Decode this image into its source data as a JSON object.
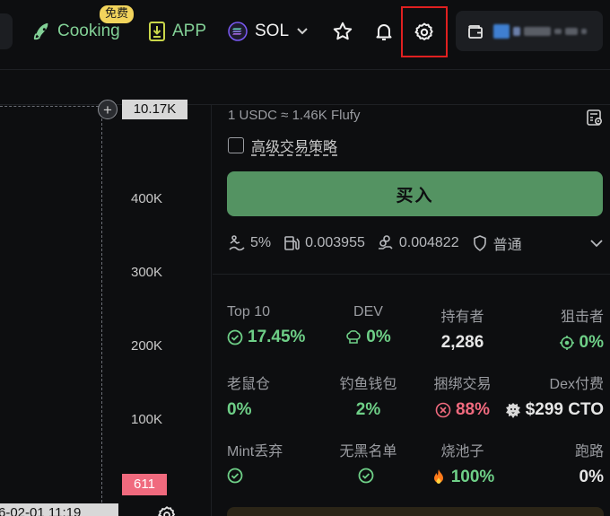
{
  "topbar": {
    "cooking_label": "Cooking",
    "free_badge": "免费",
    "app_label": "APP",
    "network_label": "SOL",
    "wallet_address_masked": "▪▪▪▪ ▪ ▪▪"
  },
  "chart": {
    "crosshair_price": "10.17K",
    "yticks": [
      "400K",
      "300K",
      "200K",
      "100K"
    ],
    "last_price_badge": "611",
    "crosshair_time": "6-02-01 11:19"
  },
  "trade": {
    "rate_text": "1 USDC ≈ 1.46K Flufy",
    "advanced_strategy_label": "高级交易策略",
    "buy_button_label": "买入",
    "slippage": "5%",
    "priority_fee": "0.003955",
    "tip_fee": "0.004822",
    "protection_mode": "普通"
  },
  "stats": [
    {
      "label": "Top 10",
      "value": "17.45%",
      "icon": "check-circle-icon",
      "color": "#6ecf87"
    },
    {
      "label": "DEV",
      "value": "0%",
      "icon": "chef-hat-icon",
      "color": "#6ecf87"
    },
    {
      "label": "持有者",
      "value": "2,286",
      "icon": "",
      "color": "#e6e6e6"
    },
    {
      "label": "狙击者",
      "value": "0%",
      "icon": "crosshair-icon",
      "color": "#6ecf87"
    },
    {
      "label": "老鼠仓",
      "value": "0%",
      "icon": "",
      "color": "#6ecf87"
    },
    {
      "label": "钓鱼钱包",
      "value": "2%",
      "icon": "",
      "color": "#6ecf87"
    },
    {
      "label": "捆绑交易",
      "value": "88%",
      "icon": "x-circle-icon",
      "color": "#f06a7e"
    },
    {
      "label": "Dex付费",
      "value": "$299 CTO",
      "icon": "lion-icon",
      "color": "#e6e6e6"
    },
    {
      "label": "Mint丢弃",
      "value": "",
      "icon": "check-circle-icon",
      "color": "#6ecf87"
    },
    {
      "label": "无黑名单",
      "value": "",
      "icon": "check-circle-icon",
      "color": "#6ecf87"
    },
    {
      "label": "烧池子",
      "value": "100%",
      "icon": "fire-icon",
      "color": "#6ecf87"
    },
    {
      "label": "跑路",
      "value": "0%",
      "icon": "",
      "color": "#e6e6e6"
    }
  ],
  "colors": {
    "accent_green": "#6ecf87",
    "buy_button": "#549362",
    "danger": "#f06a7e",
    "highlight_box": "#e02020",
    "badge_yellow": "#f2d45c"
  }
}
